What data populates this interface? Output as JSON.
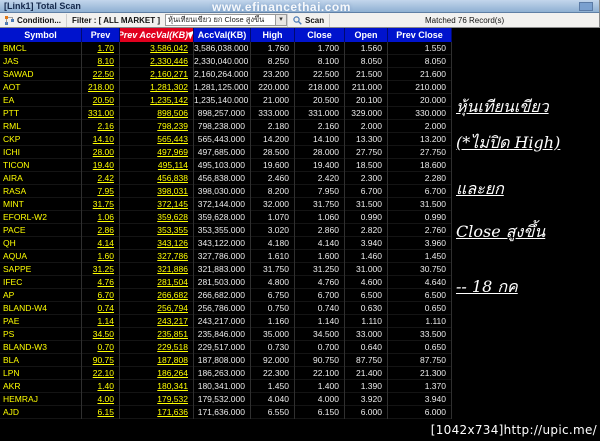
{
  "window": {
    "title": "[Link1] Total Scan"
  },
  "watermarks": {
    "site": "www.efinancethai.com",
    "bottom": "[1042x734]http://upic.me/"
  },
  "toolbar": {
    "condition_label": "Condition...",
    "filter_label": "Filter :  [ ALL MARKET ]",
    "scan_condition": "หุ้นเทียนเขียว ยก Close สูงขึ้น",
    "scan_label": "Scan",
    "matched_text": "Matched 76 Record(s)"
  },
  "colors": {
    "header_blue": "#0013cd",
    "header_red": "#e1001e",
    "link_yellow": "#ffff00",
    "value_white": "#ececec",
    "titlebar_blue": "#9fbcdc"
  },
  "table": {
    "columns": [
      {
        "key": "symbol",
        "label": "Symbol"
      },
      {
        "key": "prev",
        "label": "Prev"
      },
      {
        "key": "prev_accval",
        "label": "Prev AccVal(KB)"
      },
      {
        "key": "accval",
        "label": "AccVal(KB)"
      },
      {
        "key": "high",
        "label": "High"
      },
      {
        "key": "close",
        "label": "Close"
      },
      {
        "key": "open",
        "label": "Open"
      },
      {
        "key": "prev_close",
        "label": "Prev Close"
      }
    ],
    "rows": [
      {
        "symbol": "BMCL",
        "prev": "1.70",
        "prev_accval": "3,586,042",
        "accval": "3,586,038.000",
        "high": "1.760",
        "close": "1.700",
        "open": "1.560",
        "prev_close": "1.550"
      },
      {
        "symbol": "JAS",
        "prev": "8.10",
        "prev_accval": "2,330,446",
        "accval": "2,330,040.000",
        "high": "8.250",
        "close": "8.100",
        "open": "8.050",
        "prev_close": "8.050"
      },
      {
        "symbol": "SAWAD",
        "prev": "22.50",
        "prev_accval": "2,160,271",
        "accval": "2,160,264.000",
        "high": "23.200",
        "close": "22.500",
        "open": "21.500",
        "prev_close": "21.600"
      },
      {
        "symbol": "AOT",
        "prev": "218.00",
        "prev_accval": "1,281,302",
        "accval": "1,281,125.000",
        "high": "220.000",
        "close": "218.000",
        "open": "211.000",
        "prev_close": "210.000"
      },
      {
        "symbol": "EA",
        "prev": "20.50",
        "prev_accval": "1,235,142",
        "accval": "1,235,140.000",
        "high": "21.000",
        "close": "20.500",
        "open": "20.100",
        "prev_close": "20.000"
      },
      {
        "symbol": "PTT",
        "prev": "331.00",
        "prev_accval": "898,506",
        "accval": "898,257.000",
        "high": "333.000",
        "close": "331.000",
        "open": "329.000",
        "prev_close": "330.000"
      },
      {
        "symbol": "RML",
        "prev": "2.16",
        "prev_accval": "798,239",
        "accval": "798,238.000",
        "high": "2.180",
        "close": "2.160",
        "open": "2.000",
        "prev_close": "2.000"
      },
      {
        "symbol": "CKP",
        "prev": "14.10",
        "prev_accval": "565,443",
        "accval": "565,443.000",
        "high": "14.200",
        "close": "14.100",
        "open": "13.300",
        "prev_close": "13.200"
      },
      {
        "symbol": "ICHI",
        "prev": "28.00",
        "prev_accval": "497,969",
        "accval": "497,685.000",
        "high": "28.500",
        "close": "28.000",
        "open": "27.750",
        "prev_close": "27.750"
      },
      {
        "symbol": "TICON",
        "prev": "19.40",
        "prev_accval": "495,114",
        "accval": "495,103.000",
        "high": "19.600",
        "close": "19.400",
        "open": "18.500",
        "prev_close": "18.600"
      },
      {
        "symbol": "AIRA",
        "prev": "2.42",
        "prev_accval": "456,838",
        "accval": "456,838.000",
        "high": "2.460",
        "close": "2.420",
        "open": "2.300",
        "prev_close": "2.280"
      },
      {
        "symbol": "RASA",
        "prev": "7.95",
        "prev_accval": "398,031",
        "accval": "398,030.000",
        "high": "8.200",
        "close": "7.950",
        "open": "6.700",
        "prev_close": "6.700"
      },
      {
        "symbol": "MINT",
        "prev": "31.75",
        "prev_accval": "372,145",
        "accval": "372,144.000",
        "high": "32.000",
        "close": "31.750",
        "open": "31.500",
        "prev_close": "31.500"
      },
      {
        "symbol": "EFORL-W2",
        "prev": "1.06",
        "prev_accval": "359,628",
        "accval": "359,628.000",
        "high": "1.070",
        "close": "1.060",
        "open": "0.990",
        "prev_close": "0.990"
      },
      {
        "symbol": "PACE",
        "prev": "2.86",
        "prev_accval": "353,355",
        "accval": "353,355.000",
        "high": "3.020",
        "close": "2.860",
        "open": "2.820",
        "prev_close": "2.760"
      },
      {
        "symbol": "QH",
        "prev": "4.14",
        "prev_accval": "343,126",
        "accval": "343,122.000",
        "high": "4.180",
        "close": "4.140",
        "open": "3.940",
        "prev_close": "3.960"
      },
      {
        "symbol": "AQUA",
        "prev": "1.60",
        "prev_accval": "327,786",
        "accval": "327,786.000",
        "high": "1.610",
        "close": "1.600",
        "open": "1.460",
        "prev_close": "1.450"
      },
      {
        "symbol": "SAPPE",
        "prev": "31.25",
        "prev_accval": "321,886",
        "accval": "321,883.000",
        "high": "31.750",
        "close": "31.250",
        "open": "31.000",
        "prev_close": "30.750"
      },
      {
        "symbol": "IFEC",
        "prev": "4.76",
        "prev_accval": "281,504",
        "accval": "281,503.000",
        "high": "4.800",
        "close": "4.760",
        "open": "4.600",
        "prev_close": "4.640"
      },
      {
        "symbol": "AP",
        "prev": "6.70",
        "prev_accval": "266,682",
        "accval": "266,682.000",
        "high": "6.750",
        "close": "6.700",
        "open": "6.500",
        "prev_close": "6.500"
      },
      {
        "symbol": "BLAND-W4",
        "prev": "0.74",
        "prev_accval": "256,794",
        "accval": "256,786.000",
        "high": "0.750",
        "close": "0.740",
        "open": "0.630",
        "prev_close": "0.650"
      },
      {
        "symbol": "PAE",
        "prev": "1.14",
        "prev_accval": "243,217",
        "accval": "243,217.000",
        "high": "1.160",
        "close": "1.140",
        "open": "1.110",
        "prev_close": "1.110"
      },
      {
        "symbol": "PS",
        "prev": "34.50",
        "prev_accval": "235,851",
        "accval": "235,846.000",
        "high": "35.000",
        "close": "34.500",
        "open": "33.000",
        "prev_close": "33.500"
      },
      {
        "symbol": "BLAND-W3",
        "prev": "0.70",
        "prev_accval": "229,518",
        "accval": "229,517.000",
        "high": "0.730",
        "close": "0.700",
        "open": "0.640",
        "prev_close": "0.650"
      },
      {
        "symbol": "BLA",
        "prev": "90.75",
        "prev_accval": "187,808",
        "accval": "187,808.000",
        "high": "92.000",
        "close": "90.750",
        "open": "87.750",
        "prev_close": "87.750"
      },
      {
        "symbol": "LPN",
        "prev": "22.10",
        "prev_accval": "186,264",
        "accval": "186,263.000",
        "high": "22.300",
        "close": "22.100",
        "open": "21.400",
        "prev_close": "21.300"
      },
      {
        "symbol": "AKR",
        "prev": "1.40",
        "prev_accval": "180,341",
        "accval": "180,341.000",
        "high": "1.450",
        "close": "1.400",
        "open": "1.390",
        "prev_close": "1.370"
      },
      {
        "symbol": "HEMRAJ",
        "prev": "4.00",
        "prev_accval": "179,532",
        "accval": "179,532.000",
        "high": "4.040",
        "close": "4.000",
        "open": "3.920",
        "prev_close": "3.940"
      },
      {
        "symbol": "AJD",
        "prev": "6.15",
        "prev_accval": "171,636",
        "accval": "171,636.000",
        "high": "6.550",
        "close": "6.150",
        "open": "6.000",
        "prev_close": "6.000"
      }
    ]
  },
  "annotation": {
    "lines": [
      "หุ้นเทียนเขียว",
      "(*ไม่ปิด High)",
      "และยก",
      "Close สูงขึ้น",
      "-- 18 กค"
    ]
  }
}
